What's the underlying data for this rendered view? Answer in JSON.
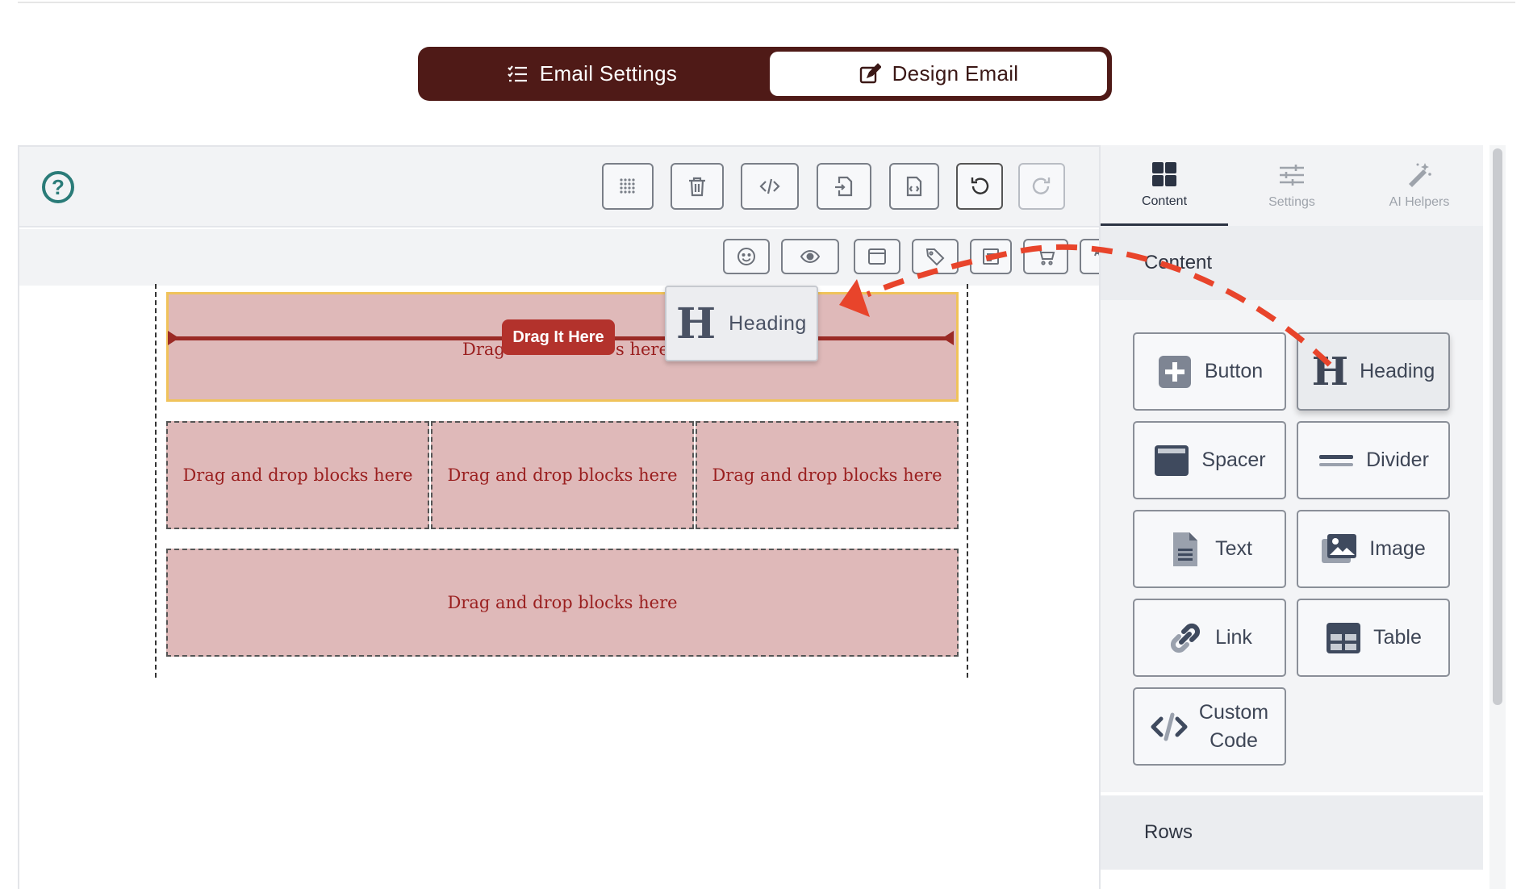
{
  "mode_switch": {
    "email_settings_label": "Email Settings",
    "design_email_label": "Design Email",
    "active": "Design Email"
  },
  "toolbar": {
    "help_icon": "question-circle-icon",
    "buttons": [
      "grid-icon",
      "trash-icon",
      "code-icon",
      "export-icon",
      "html-file-icon",
      "undo-icon",
      "redo-icon"
    ],
    "secondary_buttons": [
      "emoji-icon",
      "eye-icon",
      "browser-icon",
      "tag-icon",
      "form-icon",
      "cart-icon",
      "spellcheck-icon"
    ]
  },
  "canvas": {
    "rows": [
      {
        "placeholder": "Drag and drop blocks here",
        "columns": 1,
        "active": true
      },
      {
        "placeholders": [
          "Drag and drop blocks here",
          "Drag and drop blocks here",
          "Drag and drop blocks here"
        ],
        "columns": 3
      },
      {
        "placeholder": "Drag and drop blocks here",
        "columns": 1
      }
    ],
    "drop_hint_left": "Drag",
    "drop_hint_right": "s here",
    "drag_badge": "Drag It Here",
    "drag_ghost_label": "Heading"
  },
  "panel": {
    "tabs": [
      {
        "label": "Content",
        "icon": "grid-icon",
        "active": true
      },
      {
        "label": "Settings",
        "icon": "sliders-icon",
        "active": false
      },
      {
        "label": "AI Helpers",
        "icon": "magic-wand-icon",
        "active": false
      }
    ],
    "content_header": "Content",
    "blocks": [
      {
        "label": "Button",
        "icon": "plus-square-icon"
      },
      {
        "label": "Heading",
        "icon": "heading-icon",
        "highlighted": true
      },
      {
        "label": "Spacer",
        "icon": "spacer-icon"
      },
      {
        "label": "Divider",
        "icon": "divider-icon"
      },
      {
        "label": "Text",
        "icon": "document-icon"
      },
      {
        "label": "Image",
        "icon": "image-icon"
      },
      {
        "label": "Link",
        "icon": "link-icon"
      },
      {
        "label": "Table",
        "icon": "table-icon"
      },
      {
        "label_line1": "Custom",
        "label_line2": "Code",
        "icon": "code-icon"
      }
    ],
    "rows_header": "Rows"
  },
  "colors": {
    "brand_dark": "#4f1a17",
    "drop_zone": "#dfb9b9",
    "drop_text": "#9a1f1f",
    "badge": "#b3322c",
    "annotation": "#e8442b",
    "help": "#2a7b78"
  }
}
